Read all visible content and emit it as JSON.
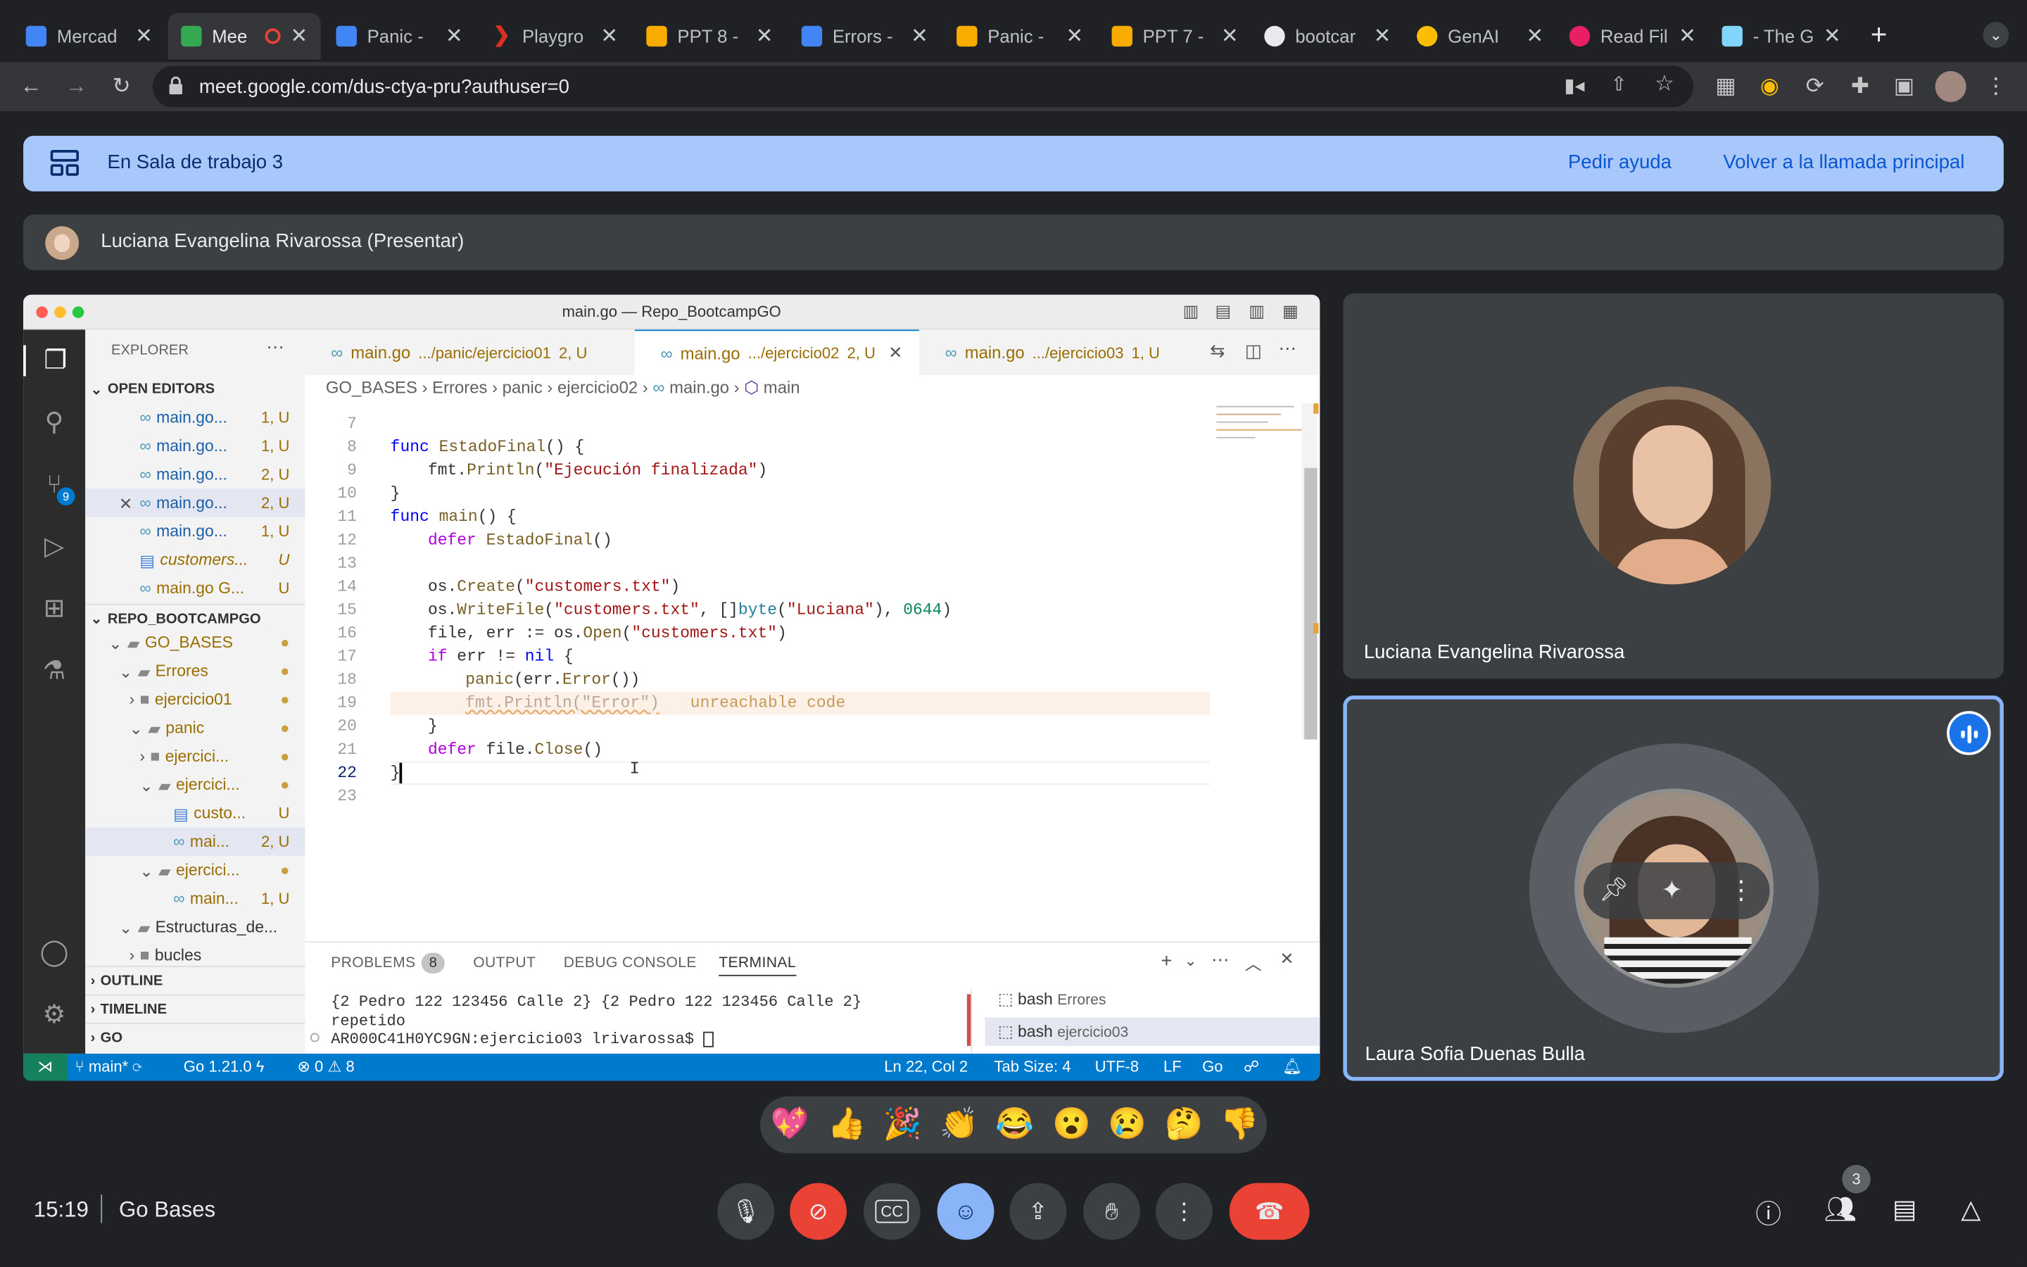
{
  "browser": {
    "tabs": [
      {
        "title": "Mercad",
        "color": "#4285f4",
        "active": false
      },
      {
        "title": "Mee",
        "color": "#34a853",
        "active": true
      },
      {
        "title": "Panic -",
        "color": "#4285f4",
        "active": false
      },
      {
        "title": "Playgro",
        "color": "#d93025",
        "active": false
      },
      {
        "title": "PPT 8 -",
        "color": "#f9ab00",
        "active": false
      },
      {
        "title": "Errors -",
        "color": "#4285f4",
        "active": false
      },
      {
        "title": "Panic -",
        "color": "#f9ab00",
        "active": false
      },
      {
        "title": "PPT 7 -",
        "color": "#f9ab00",
        "active": false
      },
      {
        "title": "bootcar",
        "color": "#e8eaed",
        "active": false
      },
      {
        "title": "GenAI",
        "color": "#fbbc04",
        "active": false
      },
      {
        "title": "Read Fil",
        "color": "#e91e63",
        "active": false
      },
      {
        "title": "- The G",
        "color": "#81d4fa",
        "active": false
      }
    ],
    "url": "meet.google.com/dus-ctya-pru?authuser=0",
    "new_tab": "+"
  },
  "meet": {
    "room_label": "En Sala de trabajo 3",
    "help_label": "Pedir ayuda",
    "return_label": "Volver a la llamada principal",
    "presenter_label": "Luciana Evangelina Rivarossa (Presentar)",
    "participants": [
      {
        "name": "Luciana Evangelina Rivarossa"
      },
      {
        "name": "Laura Sofia Duenas Bulla"
      }
    ],
    "time": "15:19",
    "meeting_name": "Go Bases",
    "participant_count": "3",
    "reactions": [
      "💖",
      "👍",
      "🎉",
      "👏",
      "😂",
      "😮",
      "😢",
      "🤔",
      "👎"
    ]
  },
  "vscode": {
    "window_title": "main.go — Repo_BootcampGO",
    "explorer_label": "EXPLORER",
    "open_editors_label": "OPEN EDITORS",
    "open_editors": [
      {
        "name": "main.go...",
        "badge": "1, U"
      },
      {
        "name": "main.go...",
        "badge": "1, U"
      },
      {
        "name": "main.go...",
        "badge": "2, U"
      },
      {
        "name": "main.go...",
        "badge": "2, U"
      },
      {
        "name": "main.go...",
        "badge": "1, U"
      },
      {
        "name": "customers...",
        "badge": "U"
      },
      {
        "name": "main.go G...",
        "badge": "U"
      }
    ],
    "repo_label": "REPO_BOOTCAMPGO",
    "tree": [
      {
        "name": "GO_BASES"
      },
      {
        "name": "Errores"
      },
      {
        "name": "ejercicio01"
      },
      {
        "name": "panic"
      },
      {
        "name": "ejercici..."
      },
      {
        "name": "ejercici..."
      },
      {
        "name": "custo...",
        "badge": "U"
      },
      {
        "name": "mai...",
        "badge": "2, U"
      },
      {
        "name": "ejercici..."
      },
      {
        "name": "main...",
        "badge": "1, U"
      },
      {
        "name": "Estructuras_de..."
      },
      {
        "name": "bucles"
      }
    ],
    "outline_label": "OUTLINE",
    "timeline_label": "TIMELINE",
    "go_label": "GO",
    "editor_tabs": [
      {
        "name": "main.go",
        "path": ".../panic/ejercicio01",
        "badge": "2, U"
      },
      {
        "name": "main.go",
        "path": ".../ejercicio02",
        "badge": "2, U"
      },
      {
        "name": "main.go",
        "path": ".../ejercicio03",
        "badge": "1, U"
      }
    ],
    "breadcrumb": [
      "GO_BASES",
      "Errores",
      "panic",
      "ejercicio02",
      "main.go",
      "main"
    ],
    "line_numbers": [
      "7",
      "8",
      "9",
      "10",
      "11",
      "12",
      "13",
      "14",
      "15",
      "16",
      "17",
      "18",
      "19",
      "20",
      "21",
      "22",
      "23"
    ],
    "code": {
      "l8a": "func ",
      "l8b": "EstadoFinal",
      "l8c": "() {",
      "l9a": "fmt.",
      "l9b": "Println",
      "l9c": "(",
      "l9d": "\"Ejecución finalizada\"",
      "l9e": ")",
      "l10": "}",
      "l11a": "func ",
      "l11b": "main",
      "l11c": "() {",
      "l12a": "defer ",
      "l12b": "EstadoFinal",
      "l12c": "()",
      "l14a": "os.",
      "l14b": "Create",
      "l14c": "(",
      "l14d": "\"customers.txt\"",
      "l14e": ")",
      "l15a": "os.",
      "l15b": "WriteFile",
      "l15c": "(",
      "l15d": "\"customers.txt\"",
      "l15e": ", []",
      "l15f": "byte",
      "l15g": "(",
      "l15h": "\"Luciana\"",
      "l15i": "), ",
      "l15j": "0644",
      "l15k": ")",
      "l16a": "file, err := os.",
      "l16b": "Open",
      "l16c": "(",
      "l16d": "\"customers.txt\"",
      "l16e": ")",
      "l17a": "if ",
      "l17b": "err != ",
      "l17c": "nil",
      "l17d": " {",
      "l18a": "panic",
      "l18b": "(err.",
      "l18c": "Error",
      "l18d": "())",
      "l19a": "fmt.Println(\"Error\")",
      "l19hint": "unreachable code",
      "l20": "}",
      "l21a": "defer ",
      "l21b": "file.",
      "l21c": "Close",
      "l21d": "()",
      "l22": "}"
    },
    "panel_tabs": [
      "PROBLEMS",
      "OUTPUT",
      "DEBUG CONSOLE",
      "TERMINAL"
    ],
    "problems_count": "8",
    "terminal_lines": [
      "{2 Pedro 122 123456 Calle 2} {2 Pedro 122 123456 Calle 2}",
      "repetido",
      "AR000C41H0YC9GN:ejercicio03 lrivarossa$ "
    ],
    "terminals": [
      {
        "shell": "bash",
        "dir": "Errores"
      },
      {
        "shell": "bash",
        "dir": "ejercicio03"
      }
    ],
    "status": {
      "branch": "main*",
      "go_version": "Go 1.21.0",
      "errors": "0",
      "warnings": "8",
      "position": "Ln 22, Col 2",
      "tab_size": "Tab Size: 4",
      "encoding": "UTF-8",
      "eol": "LF",
      "language": "Go"
    },
    "source_control_badge": "9"
  }
}
